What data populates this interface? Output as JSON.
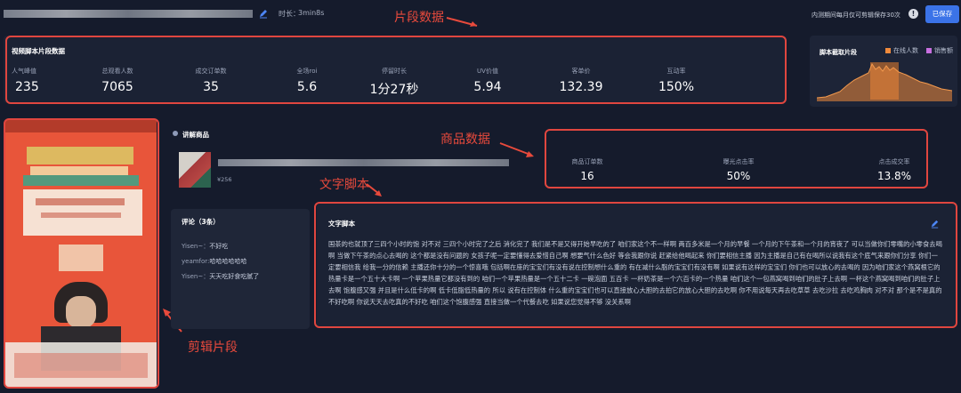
{
  "header": {
    "duration_label": "时长：",
    "duration_value": "3min8s",
    "notice": "内测期间每月仅可剪辑保存30次",
    "save_label": "已保存"
  },
  "annotations": {
    "clip_data": "片段数据",
    "product_data": "商品数据",
    "script": "文字脚本",
    "clip_segment": "剪辑片段"
  },
  "stats": {
    "title": "视频脚本片段数据",
    "items": [
      {
        "label": "人气峰值",
        "value": "235"
      },
      {
        "label": "总观看人数",
        "value": "7065"
      },
      {
        "label": "成交订单数",
        "value": "35"
      },
      {
        "label": "全场roi",
        "value": "5.6"
      },
      {
        "label": "停留时长",
        "value": "1分27秒"
      },
      {
        "label": "UV价值",
        "value": "5.94"
      },
      {
        "label": "客单价",
        "value": "132.39"
      },
      {
        "label": "互动率",
        "value": "150%"
      }
    ]
  },
  "mini_chart": {
    "title": "脚本截取片段",
    "legend": [
      {
        "name": "在线人数",
        "color": "#f08a3c"
      },
      {
        "name": "销售额",
        "color": "#c86fe0"
      }
    ]
  },
  "product": {
    "section_title": "讲解商品",
    "price": "¥256",
    "metrics": [
      {
        "label": "商品订单数",
        "value": "16"
      },
      {
        "label": "曝光点击率",
        "value": "50%"
      },
      {
        "label": "点击成交率",
        "value": "13.8%"
      }
    ]
  },
  "comments": {
    "title": "评论（3条）",
    "items": [
      {
        "user": "Yisen~：",
        "text": "不好吃"
      },
      {
        "user": "yeamfor:",
        "text": "哈哈哈哈哈哈"
      },
      {
        "user": "Yisen~：",
        "text": "天天吃好食吃腻了"
      }
    ]
  },
  "script": {
    "title": "文字脚本",
    "body": "国茶的也就顶了三四个小时的饱 对不对 三四个小时完了之后 消化完了 我们是不是又得开始早吃的了 咱们家这个不一样啊 两百多米是一个月的早餐 一个月的下午茶和一个月的宵夜了 可以当做你们零嘴的小零食去喝啊 当做下午茶的点心去喝的 这个都是没有问题的 女孩子呢一定要懂得去爱惜自己啊 想要气什么色好 等会我跟你说 赶紧给他喝起来 你们要相信主播 因为主播是自己有在喝所以说我有这个底气来跟你们分享 你们一定要相信我 给我一分的信赖 主播还你十分的一个惊喜哦 包括啊在座的宝宝们有没有说在控制想什么重的 有在减什么脂的宝宝们有没有啊 如果说有这样的宝宝们 你们也可以放心的去喝的 因为咱们家这个燕窝根它的热量卡是一个五十大卡啊 一个苹果热量它都没有到的 咱们一个苹果热量是一个五十二卡 一碗泡面 五百卡 一杯奶茶是一个六百卡的一个热量 咱们这个一包燕窝喝到咱们的肚子上去啊 一杯这个燕窝喝到咱们的肚子上去啊 饱腹感又强 并且是什么低卡的啊 低卡低脂低热量的 所以 说有在控制体 什么重的宝宝们也可以直接放心大胆的去拍它的放心大胆的去吃啊 你不用说每天再去吃草草 去吃沙拉 去吃鸡胸肉 对不对 那个是不是真的不好吃啊 你说天天去吃真的不好吃 咱们这个饱腹感强 直接当做一个代餐去吃 如果说您觉得不够 没关系啊"
  }
}
